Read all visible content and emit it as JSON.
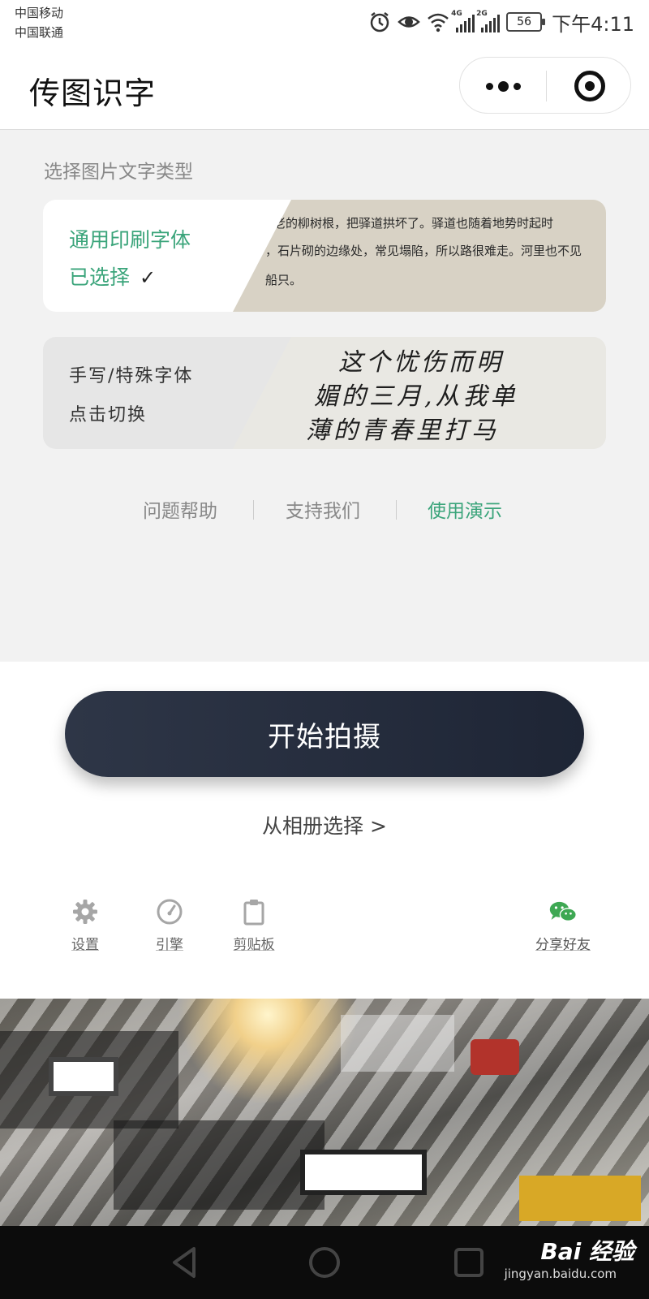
{
  "status_bar": {
    "carrier_1": "中国移动",
    "carrier_2": "中国联通",
    "signal_1": "4G",
    "signal_2": "2G",
    "battery": "56",
    "time": "下午4:11"
  },
  "header": {
    "title": "传图识字"
  },
  "main": {
    "section_label": "选择图片文字类型",
    "printed_card": {
      "title": "通用印刷字体",
      "status": "已选择",
      "check": "✓",
      "sample_lines": [
        "老的柳树根，把驿道拱坏了。驿道也随着地势时起时",
        "，石片砌的边缘处，常见塌陷，所以路很难走。河里也不见",
        "船只。"
      ]
    },
    "handwritten_card": {
      "title": "手写/特殊字体",
      "action": "点击切换",
      "sample_lines": [
        "这个忧伤而明",
        "媚的三月,从我单",
        "薄的青春里打马"
      ]
    },
    "links": {
      "help": "问题帮助",
      "support": "支持我们",
      "demo": "使用演示"
    }
  },
  "panel": {
    "shoot_button": "开始拍摄",
    "album_link": "从相册选择 >",
    "tools": {
      "settings": "设置",
      "engine": "引擎",
      "clipboard": "剪贴板",
      "share": "分享好友"
    }
  },
  "watermark": {
    "brand": "Bai 经验",
    "url": "jingyan.baidu.com"
  },
  "colors": {
    "accent_green": "#3aa47a",
    "button_dark": "#262e3f"
  }
}
